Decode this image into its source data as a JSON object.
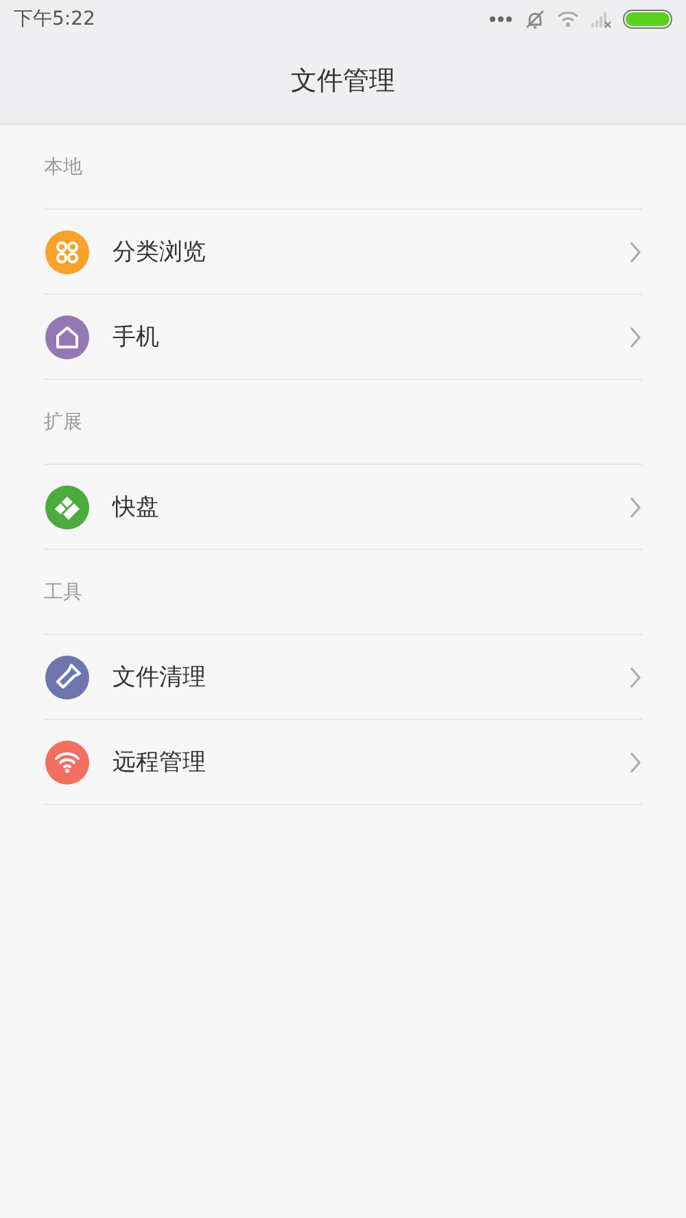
{
  "status_bar": {
    "time": "下午5:22"
  },
  "title": "文件管理",
  "sections": [
    {
      "header": "本地",
      "items": [
        {
          "label": "分类浏览",
          "kind": "categories",
          "color": "#f9a22a"
        },
        {
          "label": "手机",
          "kind": "phone",
          "color": "#9478b4"
        }
      ]
    },
    {
      "header": "扩展",
      "items": [
        {
          "label": "快盘",
          "kind": "cloud",
          "color": "#4caa3e"
        }
      ]
    },
    {
      "header": "工具",
      "items": [
        {
          "label": "文件清理",
          "kind": "clean",
          "color": "#6e77ad"
        },
        {
          "label": "远程管理",
          "kind": "remote",
          "color": "#f36f5f"
        }
      ]
    }
  ]
}
